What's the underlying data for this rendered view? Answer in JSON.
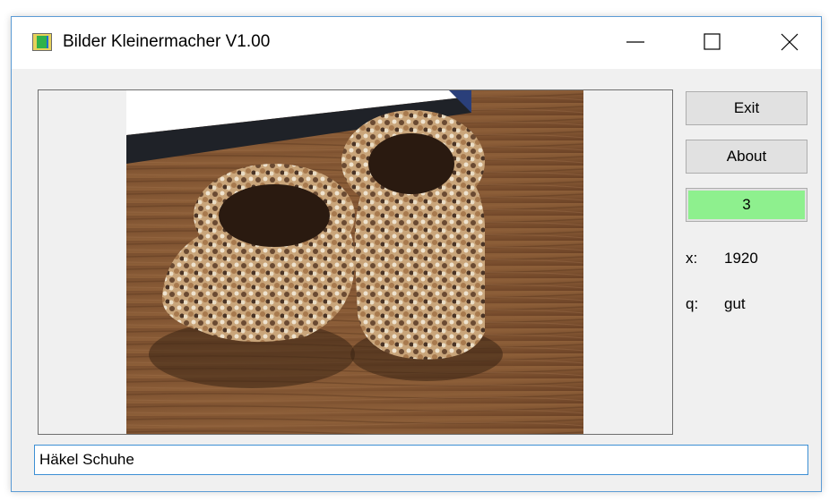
{
  "window": {
    "title": "Bilder Kleinermacher V1.00",
    "app_icon": "app-icon",
    "controls": {
      "minimize": "minimize-icon",
      "maximize": "maximize-icon",
      "close": "close-icon"
    }
  },
  "image": {
    "description_icon": "photo",
    "alt": "Häkel Schuhe"
  },
  "buttons": {
    "exit_label": "Exit",
    "about_label": "About"
  },
  "counter": {
    "value": "3",
    "color": "#8ef08e"
  },
  "info": {
    "x_label": "x:",
    "x_value": "1920",
    "q_label": "q:",
    "q_value": "gut"
  },
  "caption_input": {
    "value": "Häkel Schuhe"
  }
}
